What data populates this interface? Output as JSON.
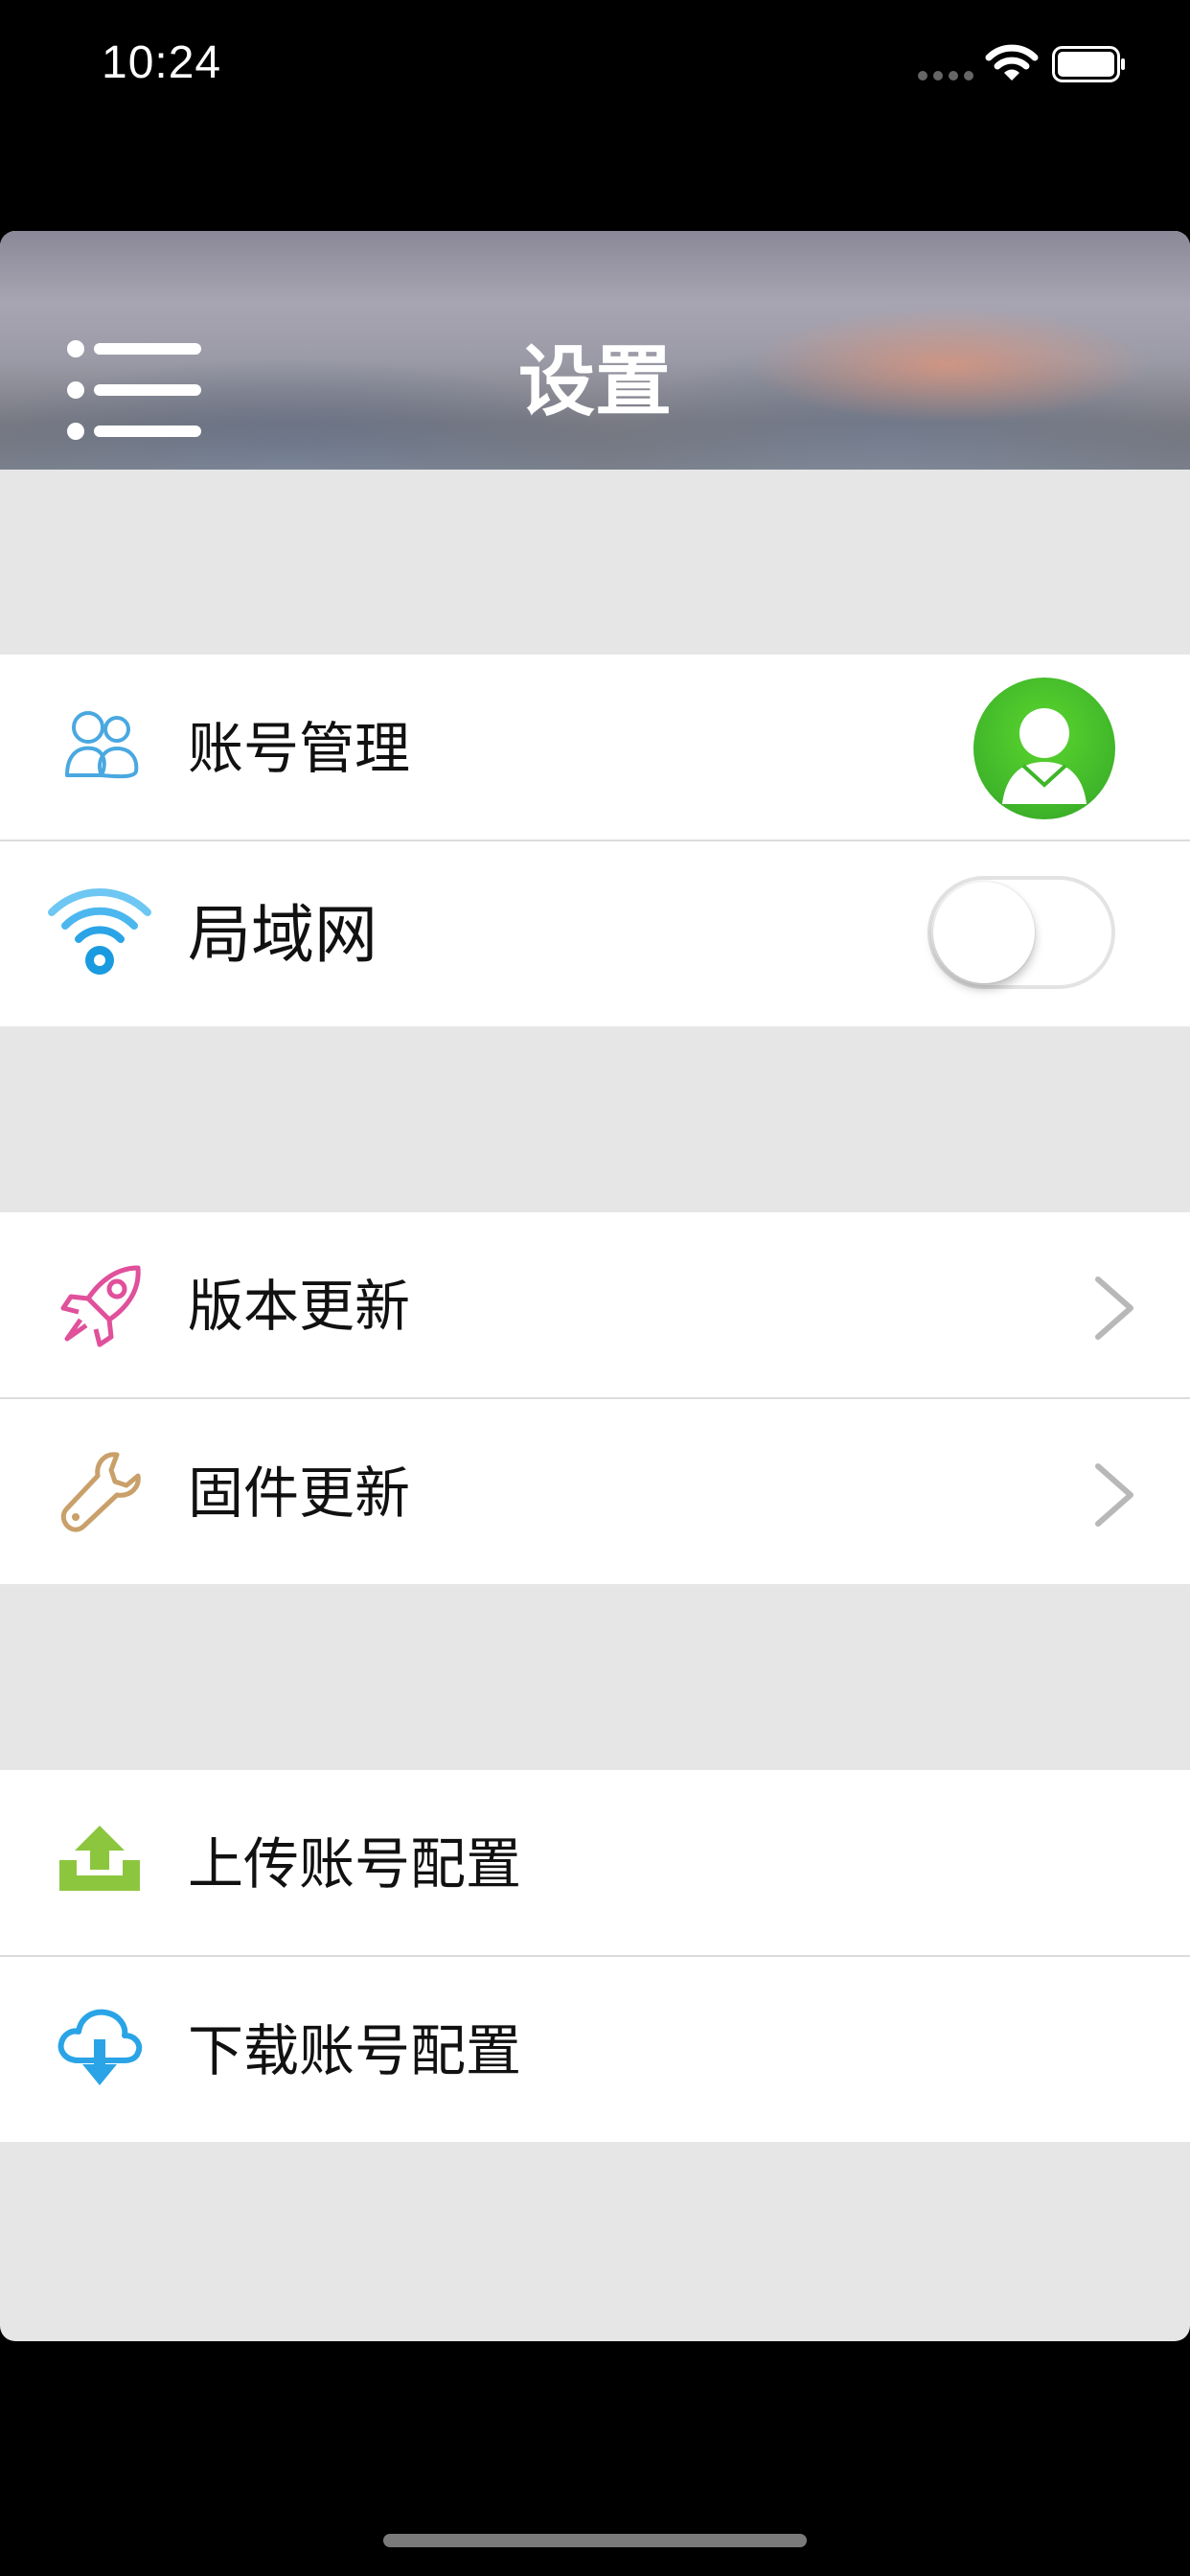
{
  "status_bar": {
    "time": "10:24"
  },
  "header": {
    "title": "设置",
    "menu_icon": "list-menu-icon"
  },
  "groups": [
    {
      "items": [
        {
          "label": "账号管理",
          "icon": "users-icon",
          "accessory": "avatar",
          "accent": "#4aa8e0"
        },
        {
          "label": "局域网",
          "icon": "wifi-icon",
          "accessory": "toggle",
          "toggle_on": false,
          "accent": "#1aa3e8"
        }
      ]
    },
    {
      "items": [
        {
          "label": "版本更新",
          "icon": "rocket-icon",
          "accessory": "chevron",
          "accent": "#e0509b"
        },
        {
          "label": "固件更新",
          "icon": "wrench-icon",
          "accessory": "chevron",
          "accent": "#c9a06a"
        }
      ]
    },
    {
      "items": [
        {
          "label": "上传账号配置",
          "icon": "upload-icon",
          "accessory": "none",
          "accent": "#8cc63f"
        },
        {
          "label": "下载账号配置",
          "icon": "cloud-download-icon",
          "accessory": "none",
          "accent": "#2aa4e6"
        }
      ]
    }
  ],
  "colors": {
    "background": "#e6e6e6",
    "avatar_green": "#3fb52a",
    "chevron": "#b8b8b8"
  }
}
